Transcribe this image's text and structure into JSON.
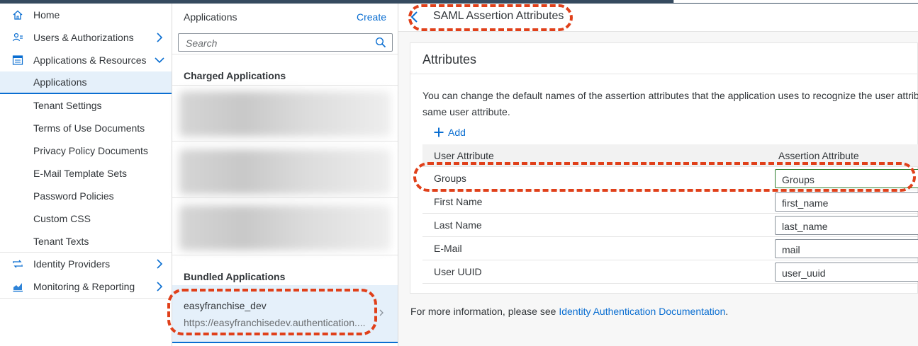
{
  "nav": {
    "items": [
      {
        "label": "Home",
        "icon": "home-icon"
      },
      {
        "label": "Users & Authorizations",
        "icon": "users-icon",
        "chevron": "right"
      },
      {
        "label": "Applications & Resources",
        "icon": "applications-icon",
        "chevron": "down"
      },
      {
        "label": "Applications",
        "selected": true
      },
      {
        "label": "Tenant Settings"
      },
      {
        "label": "Terms of Use Documents"
      },
      {
        "label": "Privacy Policy Documents"
      },
      {
        "label": "E-Mail Template Sets"
      },
      {
        "label": "Password Policies"
      },
      {
        "label": "Custom CSS"
      },
      {
        "label": "Tenant Texts"
      },
      {
        "label": "Identity Providers",
        "icon": "identity-providers-icon",
        "chevron": "right"
      },
      {
        "label": "Monitoring & Reporting",
        "icon": "monitoring-icon",
        "chevron": "right"
      }
    ]
  },
  "list": {
    "title": "Applications",
    "create_label": "Create",
    "search_placeholder": "Search",
    "charged_header": "Charged Applications",
    "bundled_header": "Bundled Applications",
    "selected_app": {
      "name": "easyfranchise_dev",
      "url": "https://easyfranchisedev.authentication...."
    }
  },
  "detail": {
    "title": "SAML Assertion Attributes",
    "panel_title": "Attributes",
    "description": "You can change the default names of the assertion attributes that the application uses to recognize the user attribu\nsame user attribute.",
    "add_label": "Add",
    "columns": {
      "user_attribute": "User Attribute",
      "assertion_attribute": "Assertion Attribute"
    },
    "rows": [
      {
        "user": "Groups",
        "assertion": "Groups"
      },
      {
        "user": "First Name",
        "assertion": "first_name"
      },
      {
        "user": "Last Name",
        "assertion": "last_name"
      },
      {
        "user": "E-Mail",
        "assertion": "mail"
      },
      {
        "user": "User UUID",
        "assertion": "user_uuid"
      }
    ],
    "footer_prefix": "For more information, please see ",
    "footer_link": "Identity Authentication Documentation",
    "footer_suffix": "."
  },
  "colors": {
    "accent": "#0a6ed1",
    "annotation": "#e0401a",
    "shell": "#354a5f"
  }
}
